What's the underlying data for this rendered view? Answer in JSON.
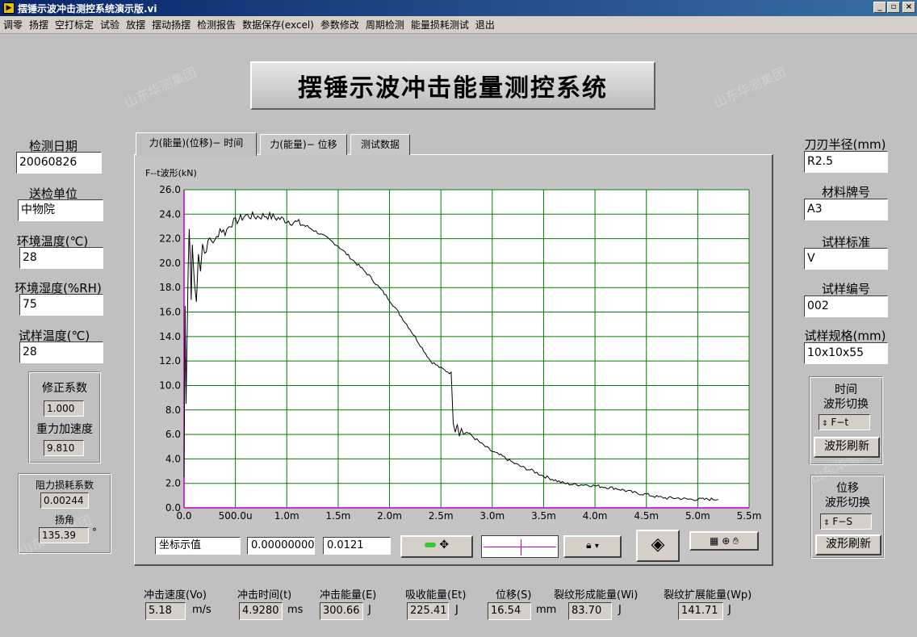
{
  "window": {
    "title": "摆锤示波冲击测控系统演示版.vi",
    "minimize": "_",
    "maximize": "▫",
    "close": "×"
  },
  "menu": [
    "调零",
    "扬摆",
    "空打标定",
    "试验",
    "放摆",
    "摆动扬摆",
    "检测报告",
    "数据保存(excel)",
    "参数修改",
    "周期检测",
    "能量损耗测试",
    "退出"
  ],
  "banner": "摆锤示波冲击能量测控系统",
  "watermark": "山东华测集团",
  "left": {
    "date_label": "检测日期",
    "date_value": "20060826",
    "unit_label": "送检单位",
    "unit_value": "中物院",
    "env_temp_label": "环境温度(℃)",
    "env_temp_value": "28",
    "env_hum_label": "环境湿度(%RH)",
    "env_hum_value": "75",
    "sample_temp_label": "试样温度(℃)",
    "sample_temp_value": "28",
    "corr_label": "修正系数",
    "corr_value": "1.000",
    "grav_label": "重力加速度",
    "grav_value": "9.810",
    "res_label": "阻力损耗系数",
    "res_value": "0.00244",
    "angle_label": "扬角",
    "angle_value": "135.39",
    "angle_unit": "°"
  },
  "right": {
    "blade_label": "刀刃半径(mm)",
    "blade_value": "R2.5",
    "material_label": "材料牌号",
    "material_value": "A3",
    "standard_label": "试样标准",
    "standard_value": "V",
    "sample_no_label": "试样编号",
    "sample_no_value": "002",
    "spec_label": "试样规格(mm)",
    "spec_value": "10x10x55",
    "time_group_title1": "时间",
    "time_group_title2": "波形切换",
    "time_switch_value": "F−t",
    "time_refresh": "波形刷新",
    "disp_group_title1": "位移",
    "disp_group_title2": "波形切换",
    "disp_switch_value": "F−S",
    "disp_refresh": "波形刷新"
  },
  "tabs": [
    "力(能量)(位移)− 时间",
    "力(能量)− 位移",
    "测试数据"
  ],
  "graph_toolbar": {
    "cursor_label": "坐标示值",
    "cursor_x": "0.00000000",
    "cursor_y": "0.0121"
  },
  "bottom": {
    "speed_label": "冲击速度(Vo)",
    "speed_value": "5.18",
    "speed_unit": "m/s",
    "time_label": "冲击时间(t)",
    "time_value": "4.9280",
    "time_unit": "ms",
    "energy_label": "冲击能量(E)",
    "energy_value": "300.66",
    "energy_unit": "J",
    "absorb_label": "吸收能量(Et)",
    "absorb_value": "225.41",
    "absorb_unit": "J",
    "disp_label": "位移(S)",
    "disp_value": "16.54",
    "disp_unit": "mm",
    "wi_label": "裂纹形成能量(Wi)",
    "wi_value": "83.70",
    "wi_unit": "J",
    "wp_label": "裂纹扩展能量(Wp)",
    "wp_value": "141.71",
    "wp_unit": "J"
  },
  "colors": {
    "grid": "#008000",
    "curve": "#000000",
    "axis": "#c000c0",
    "plot_bg": "#ffffff"
  },
  "chart_data": {
    "type": "line",
    "title": "F--t波形(kN)",
    "xlim": [
      0,
      0.0055
    ],
    "ylim": [
      0,
      26
    ],
    "xticks": [
      0,
      0.0005,
      0.001,
      0.0015,
      0.002,
      0.0025,
      0.003,
      0.0035,
      0.004,
      0.0045,
      0.005,
      0.0055
    ],
    "xtick_labels": [
      "0.0",
      "500.0u",
      "1.0m",
      "1.5m",
      "2.0m",
      "2.5m",
      "3.0m",
      "3.5m",
      "4.0m",
      "4.5m",
      "5.0m",
      "5.5m"
    ],
    "yticks": [
      0,
      2,
      4,
      6,
      8,
      10,
      12,
      14,
      16,
      18,
      20,
      22,
      24,
      26
    ],
    "ytick_labels": [
      "0.0",
      "2.0",
      "4.0",
      "6.0",
      "8.0",
      "10.0",
      "12.0",
      "14.0",
      "16.0",
      "18.0",
      "20.0",
      "22.0",
      "24.0",
      "26.0"
    ],
    "grid": true,
    "series": [
      {
        "x": [
          0,
          1e-05,
          2e-05,
          3e-05,
          4e-05,
          5e-05,
          6e-05,
          7e-05,
          8e-05,
          0.0001,
          0.00012,
          0.00014,
          0.00016,
          0.00018,
          0.0002,
          0.00025,
          0.0003,
          0.00035,
          0.0004,
          0.00045,
          0.0005,
          0.0006,
          0.0007,
          0.0008,
          0.0009,
          0.001,
          0.0011,
          0.0012,
          0.0013,
          0.0014,
          0.0015,
          0.0016,
          0.0017,
          0.0018,
          0.0019,
          0.002,
          0.0021,
          0.0022,
          0.0023,
          0.0024,
          0.0025,
          0.0026,
          0.00262,
          0.00264,
          0.00266,
          0.00268,
          0.0027,
          0.00272,
          0.00275,
          0.0028,
          0.0029,
          0.003,
          0.0031,
          0.0032,
          0.0033,
          0.0034,
          0.0035,
          0.0036,
          0.0037,
          0.0038,
          0.0039,
          0.004,
          0.0041,
          0.0042,
          0.0043,
          0.0044,
          0.0045,
          0.0046,
          0.0047,
          0.0048,
          0.0049,
          0.005,
          0.0051,
          0.0052
        ],
        "y": [
          2.5,
          16.5,
          8.5,
          14.0,
          19.5,
          22.8,
          20.5,
          17.0,
          21.5,
          18.5,
          16.8,
          21.0,
          19.5,
          21.6,
          20.8,
          22.0,
          21.7,
          22.8,
          22.5,
          23.2,
          23.4,
          23.9,
          23.8,
          23.9,
          23.7,
          23.5,
          23.3,
          23.0,
          22.5,
          22.0,
          21.4,
          20.6,
          19.8,
          19.0,
          18.0,
          17.0,
          15.8,
          14.6,
          13.3,
          12.0,
          11.4,
          11.0,
          7.0,
          6.3,
          6.9,
          5.9,
          6.6,
          6.0,
          6.2,
          5.9,
          5.2,
          4.6,
          4.2,
          3.7,
          3.3,
          3.0,
          2.6,
          2.3,
          2.0,
          1.9,
          1.9,
          1.8,
          1.7,
          1.6,
          1.4,
          1.2,
          1.1,
          0.9,
          0.8,
          0.8,
          0.7,
          0.7,
          0.7,
          0.7
        ]
      }
    ]
  }
}
